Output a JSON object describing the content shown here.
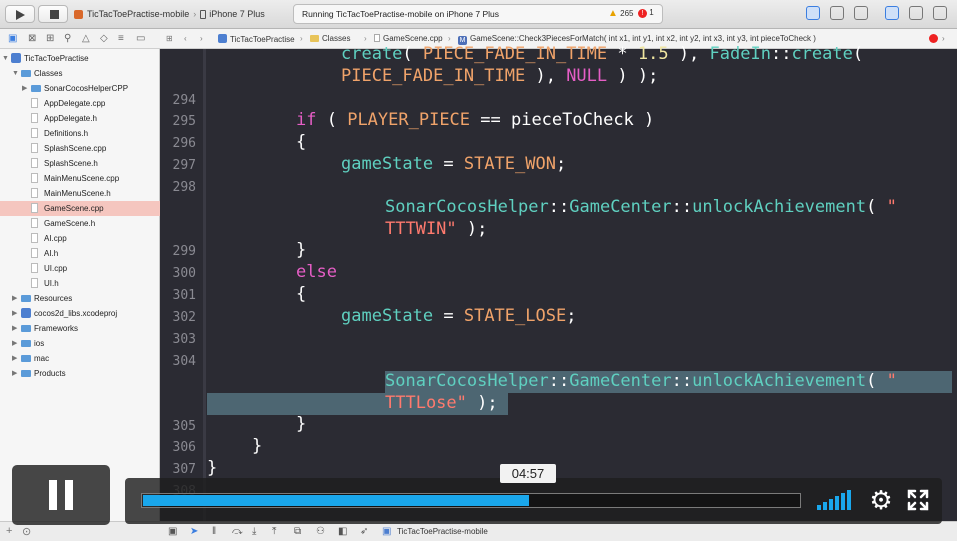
{
  "toolbar": {
    "scheme_name": "TicTacToePractise-mobile",
    "scheme_sep": "›",
    "device_name": "iPhone 7 Plus",
    "activity_text": "Running TicTacToePractise-mobile on iPhone 7 Plus",
    "warnings_count": "265",
    "errors_count": "1"
  },
  "navigator": {
    "items": [
      {
        "label": "TicTacToePractise",
        "kind": "project",
        "level": 0,
        "disclosure": "▼"
      },
      {
        "label": "Classes",
        "kind": "folder",
        "level": 1,
        "disclosure": "▼"
      },
      {
        "label": "SonarCocosHelperCPP",
        "kind": "folder",
        "level": 2,
        "disclosure": "▶"
      },
      {
        "label": "AppDelegate.cpp",
        "kind": "file",
        "level": 2
      },
      {
        "label": "AppDelegate.h",
        "kind": "file",
        "level": 2
      },
      {
        "label": "Definitions.h",
        "kind": "file",
        "level": 2
      },
      {
        "label": "SplashScene.cpp",
        "kind": "file",
        "level": 2
      },
      {
        "label": "SplashScene.h",
        "kind": "file",
        "level": 2
      },
      {
        "label": "MainMenuScene.cpp",
        "kind": "file",
        "level": 2
      },
      {
        "label": "MainMenuScene.h",
        "kind": "file",
        "level": 2
      },
      {
        "label": "GameScene.cpp",
        "kind": "file",
        "level": 2,
        "selected": true
      },
      {
        "label": "GameScene.h",
        "kind": "file",
        "level": 2
      },
      {
        "label": "AI.cpp",
        "kind": "file",
        "level": 2
      },
      {
        "label": "AI.h",
        "kind": "file",
        "level": 2
      },
      {
        "label": "UI.cpp",
        "kind": "file",
        "level": 2
      },
      {
        "label": "UI.h",
        "kind": "file",
        "level": 2
      },
      {
        "label": "Resources",
        "kind": "folder",
        "level": 1,
        "disclosure": "▶"
      },
      {
        "label": "cocos2d_libs.xcodeproj",
        "kind": "project",
        "level": 1,
        "disclosure": "▶"
      },
      {
        "label": "Frameworks",
        "kind": "folder",
        "level": 1,
        "disclosure": "▶"
      },
      {
        "label": "ios",
        "kind": "folder",
        "level": 1,
        "disclosure": "▶"
      },
      {
        "label": "mac",
        "kind": "folder",
        "level": 1,
        "disclosure": "▶"
      },
      {
        "label": "Products",
        "kind": "folder",
        "level": 1,
        "disclosure": "▶"
      }
    ]
  },
  "jumpbar": {
    "project": "TicTacToePractise",
    "folder": "Classes",
    "file": "GameScene.cpp",
    "method": "GameScene::Check3PiecesForMatch( int x1, int y1, int x2, int y2, int x3, int y3, int pieceToCheck )",
    "separator": "›"
  },
  "editor": {
    "line_numbers": [
      "294",
      "295",
      "296",
      "297",
      "298",
      "299",
      "300",
      "301",
      "302",
      "303",
      "304",
      "305",
      "306",
      "307",
      "308"
    ],
    "code": {
      "l_a1": "create",
      "l_a2": "( ",
      "l_a3": "PIECE_FADE_IN_TIME",
      "l_a4": " * ",
      "l_a5": "1.5",
      "l_a6": " ), ",
      "l_a7": "FadeIn",
      "l_a8": "::",
      "l_a9": "create",
      "l_a10": "(",
      "l_b1": "PIECE_FADE_IN_TIME",
      "l_b2": " ), ",
      "l_b3": "NULL",
      "l_b4": " ) );",
      "if_kw": "if",
      "if_p1": " ( ",
      "if_m": "PLAYER_PIECE",
      "if_p2": " == pieceToCheck )",
      "brace_open": "{",
      "brace_close": "}",
      "gs": "gameState",
      "eq": " = ",
      "won": "STATE_WON",
      "lose": "STATE_LOSE",
      "semi": ";",
      "sch": "SonarCocosHelper",
      "dc": "::",
      "gc": "GameCenter",
      "ua": "unlockAchievement",
      "open_paren": "( ",
      "q": "\"",
      "ttt_win": "TTTWIN\"",
      "ttt_lose": "TTTLose\"",
      "end_call": " );",
      "else_kw": "else"
    }
  },
  "debugbar": {
    "target": "TicTacToePractise-mobile"
  },
  "player": {
    "current_time": "04:57",
    "progress": 0.589,
    "volume": 1.0,
    "accent": "#1aa7ec"
  },
  "icons": [
    "play-icon",
    "stop-icon",
    "folder-icon",
    "file-icon",
    "gear-icon",
    "fullscreen-icon",
    "volume-icon",
    "pause-icon"
  ]
}
